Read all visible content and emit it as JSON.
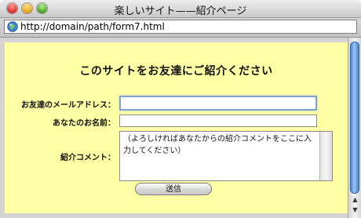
{
  "window": {
    "title": "楽しいサイト——紹介ページ",
    "url": "http://domain/path/form7.html"
  },
  "form": {
    "heading": "このサイトをお友達にご紹介ください",
    "email_label": "お友達のメールアドレス：",
    "email_value": "",
    "name_label": "あなたのお名前：",
    "name_value": "",
    "comment_label": "紹介コメント：",
    "comment_value": "（よろしければあなたからの紹介コメントをここに入力してください）",
    "submit_label": "送信"
  },
  "colors": {
    "page_background": "#ffffa5",
    "focus_ring": "#7da2ce"
  },
  "icons": {
    "site_icon": "globe-icon"
  }
}
